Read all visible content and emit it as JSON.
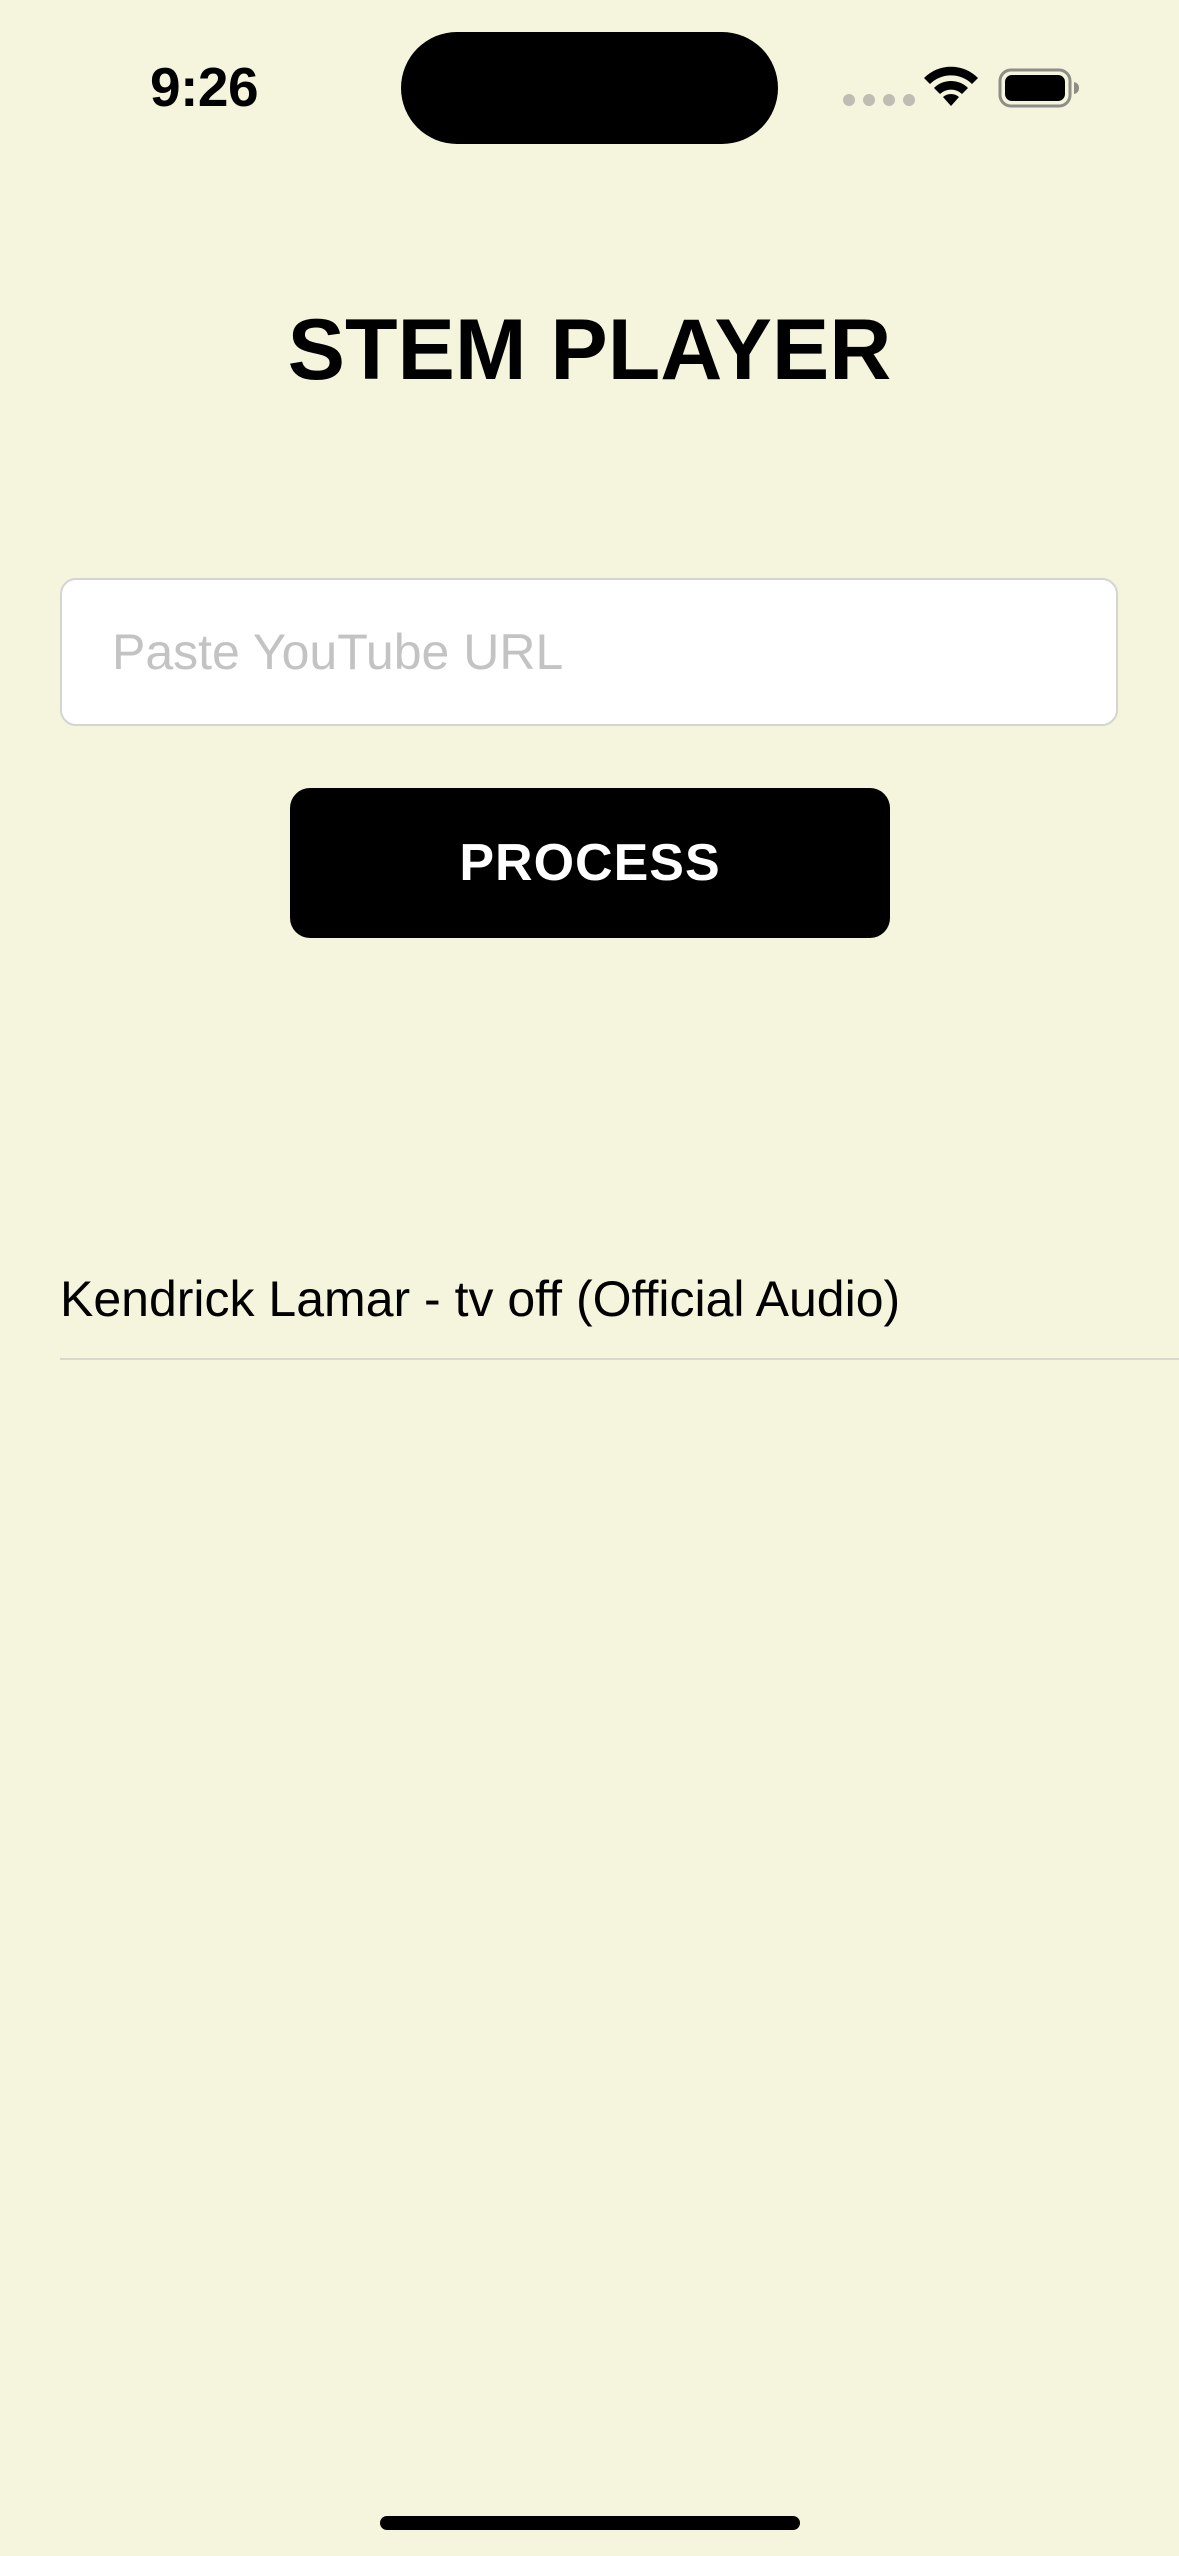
{
  "status_bar": {
    "time": "9:26",
    "icons": [
      "signal-dots-icon",
      "wifi-icon",
      "battery-icon"
    ]
  },
  "header": {
    "title": "STEM PLAYER"
  },
  "form": {
    "url_placeholder": "Paste YouTube URL",
    "url_value": "",
    "process_label": "PROCESS"
  },
  "tracks": [
    {
      "title": "Kendrick Lamar - tv off (Official Audio)"
    }
  ],
  "colors": {
    "background": "#F5F4DC",
    "button": "#000000",
    "button_text": "#FFFFFF",
    "placeholder": "#C3C3C3"
  }
}
